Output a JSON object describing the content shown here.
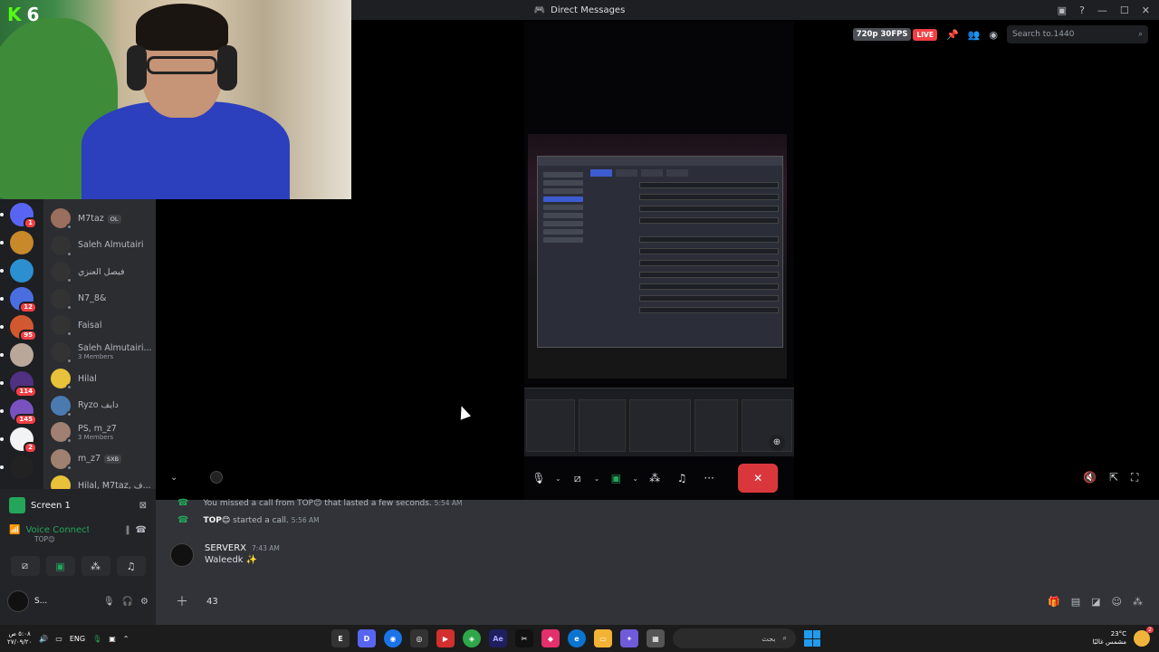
{
  "window": {
    "title": "Direct Messages"
  },
  "stream": {
    "quality": "720p 30FPS",
    "live": "LIVE",
    "search_placeholder": "Search to.1440"
  },
  "webcam": {
    "logo_letter": "K",
    "logo_number": "6"
  },
  "rail": {
    "items": [
      {
        "badge": "1",
        "color": "#5865f2"
      },
      {
        "badge": "",
        "color": "#c8892b"
      },
      {
        "badge": "",
        "color": "#2c8fcf"
      },
      {
        "badge": "12",
        "color": "#4a6ee0"
      },
      {
        "badge": "95",
        "color": "#d25830"
      },
      {
        "badge": "",
        "color": "#b9a89a"
      },
      {
        "badge": "114",
        "color": "#503080"
      },
      {
        "badge": "145",
        "color": "#7a52c0"
      },
      {
        "badge": "2",
        "color": "#f2f3f5"
      },
      {
        "badge": "",
        "color": "#222"
      }
    ]
  },
  "dms": [
    {
      "name": "M7taz",
      "tag": "OL",
      "sub": "",
      "color": "#9a6f5e"
    },
    {
      "name": "Saleh Almutairi",
      "tag": "",
      "sub": "",
      "color": "#333"
    },
    {
      "name": "فيصل العنزي",
      "tag": "",
      "sub": "",
      "color": "#333"
    },
    {
      "name": "N7_8&",
      "tag": "",
      "sub": "",
      "color": "#333"
    },
    {
      "name": "Faisal",
      "tag": "",
      "sub": "",
      "color": "#333"
    },
    {
      "name": "Saleh Almutairi...",
      "tag": "",
      "sub": "3 Members",
      "color": "#333"
    },
    {
      "name": "Hilal",
      "tag": "",
      "sub": "",
      "color": "#e8c23a"
    },
    {
      "name": "Ryzo دايف",
      "tag": "",
      "sub": "",
      "color": "#4a7ab0"
    },
    {
      "name": "PS, m_z7",
      "tag": "",
      "sub": "3 Members",
      "color": "#a08070"
    },
    {
      "name": "m_z7",
      "tag": "SXB",
      "sub": "",
      "color": "#a08070"
    },
    {
      "name": "Hilal, M7taz, ف...",
      "tag": "",
      "sub": "",
      "color": "#e8c23a"
    }
  ],
  "voice": {
    "screen_label": "Screen 1",
    "connected_label": "Voice Connected",
    "channel": "TOP😊",
    "user_short": "S..."
  },
  "chat": {
    "missed_call": "You missed a call from TOP😊 that lasted a few seconds.",
    "missed_ts": "5:54 AM",
    "started_call_user": "TOP😊",
    "started_call_text": "started a call.",
    "started_ts": "5:56 AM",
    "message": {
      "author": "SERVERX",
      "ts": "7:43 AM",
      "body": "Waleedk ✨"
    },
    "composer_value": "43"
  },
  "taskbar": {
    "time": "٥:٠٨ ص",
    "date": "٢٧/٠٩/٢٠",
    "lang": "ENG",
    "search_placeholder": "بحث",
    "weather_temp": "23°C",
    "weather_text": "مشمس غالبًا",
    "notif_count": "2"
  }
}
